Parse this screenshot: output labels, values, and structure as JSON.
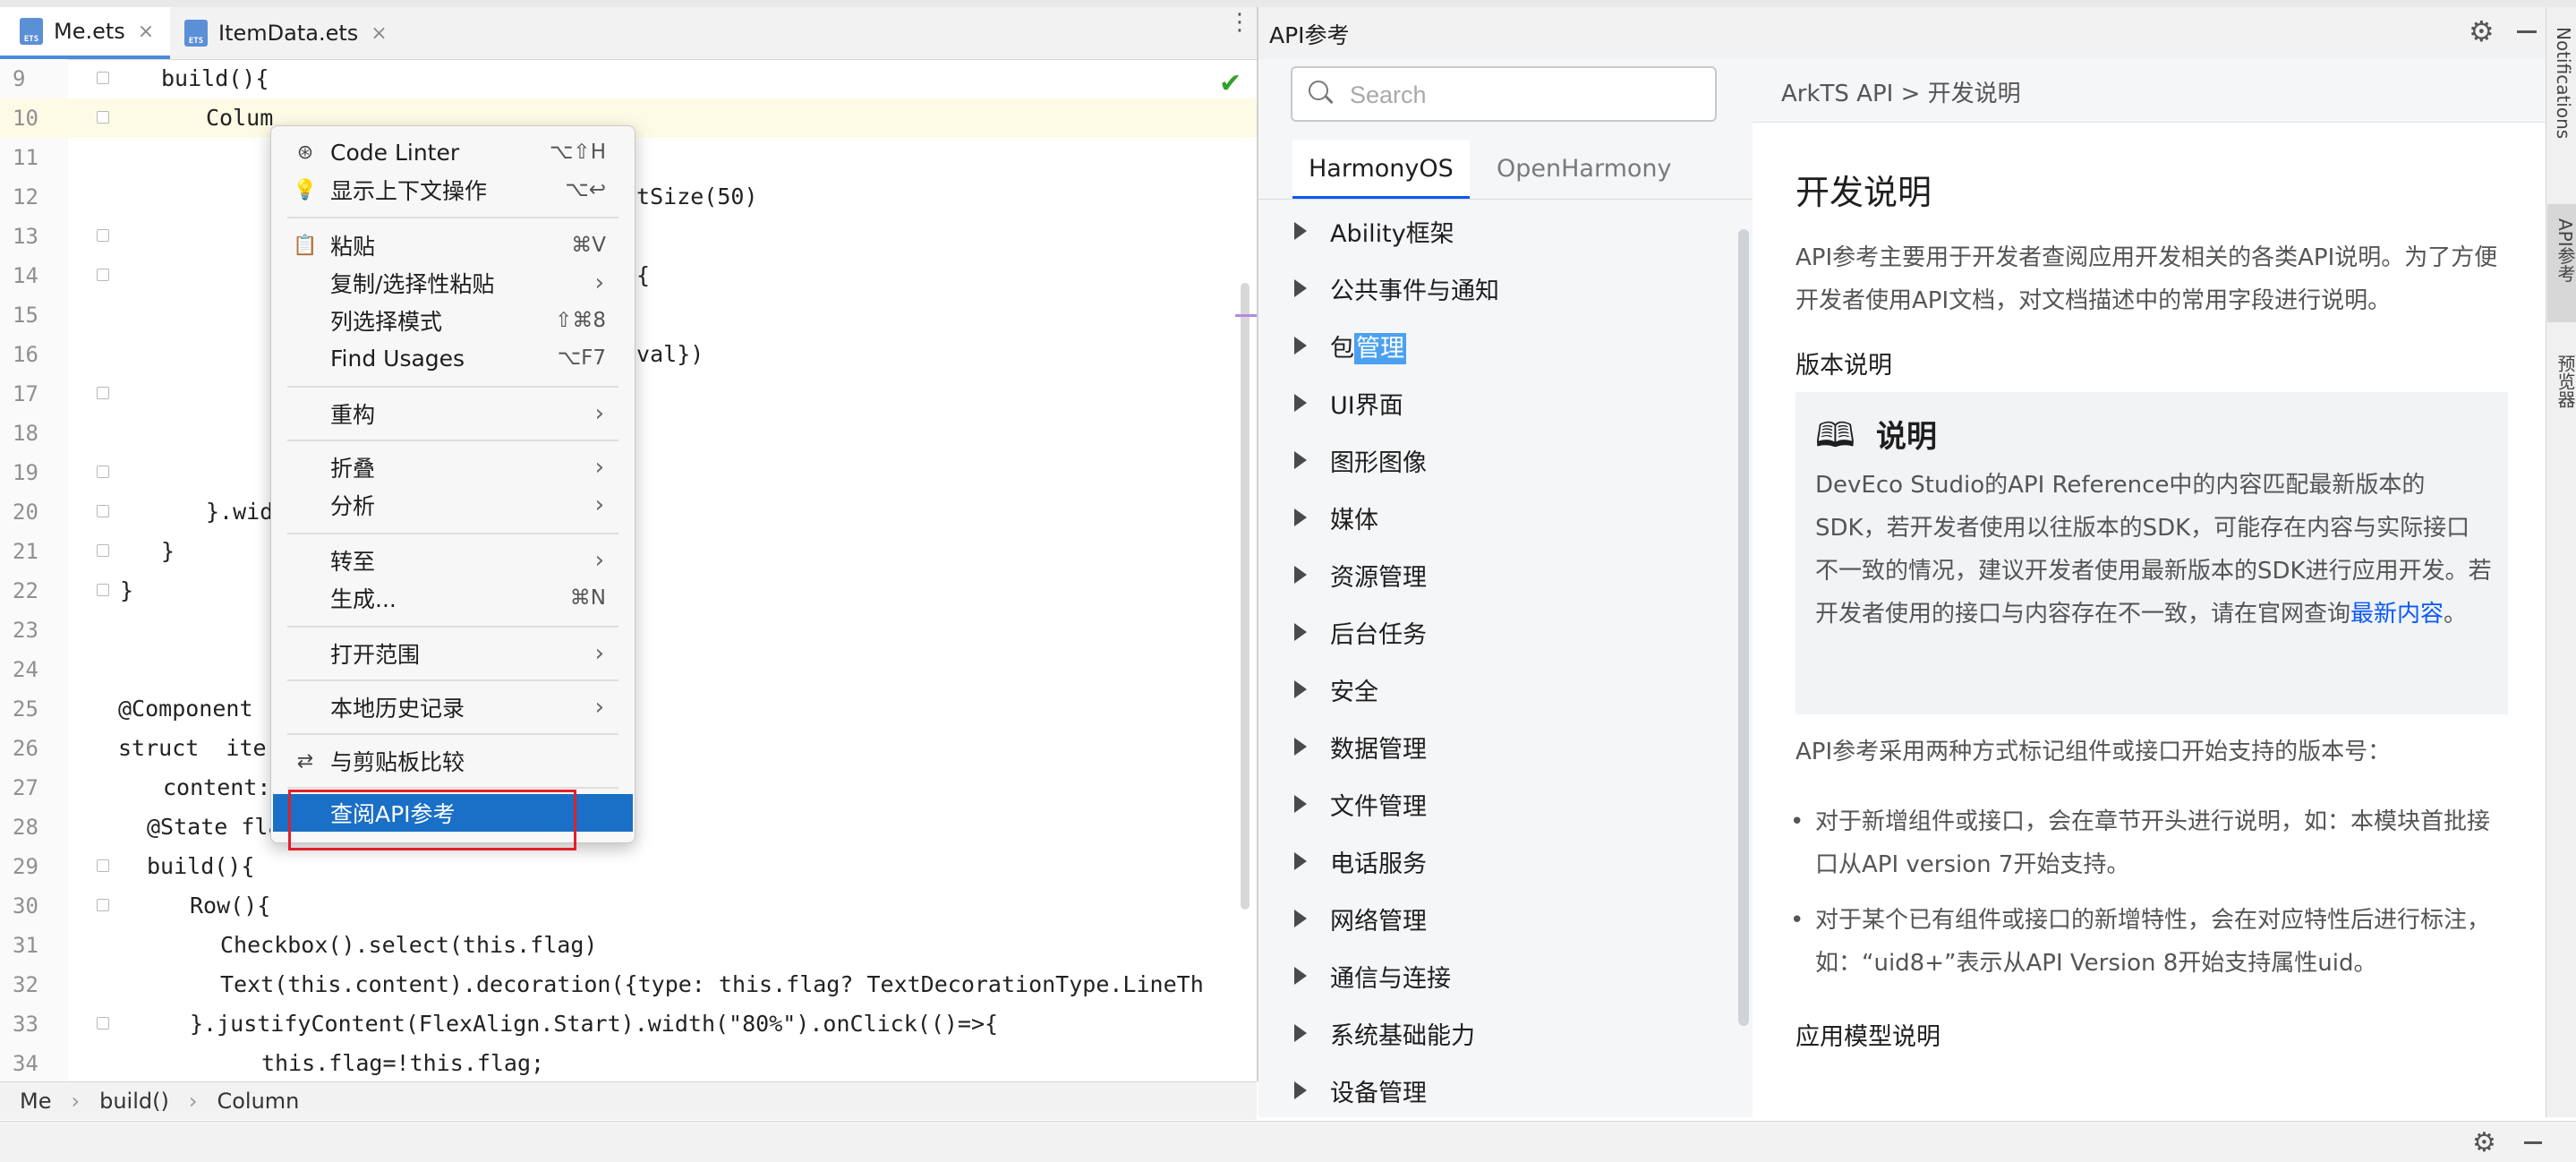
{
  "editor": {
    "tabs": [
      {
        "label": "Me.ets",
        "type": "ETS",
        "active": true
      },
      {
        "label": "ItemData.ets",
        "type": "ETS",
        "active": false
      }
    ],
    "lines": [
      {
        "n": "9",
        "code": "build(){"
      },
      {
        "n": "10",
        "code": "Colum"
      },
      {
        "n": "11",
        "code": ""
      },
      {
        "n": "12",
        "code": "ntSize(50)"
      },
      {
        "n": "13",
        "code": ""
      },
      {
        "n": "14",
        "code": ">{"
      },
      {
        "n": "15",
        "code": ""
      },
      {
        "n": "16",
        "code": ":val})"
      },
      {
        "n": "17",
        "code": ""
      },
      {
        "n": "18",
        "code": ""
      },
      {
        "n": "19",
        "code": ""
      },
      {
        "n": "20",
        "code": "}.wid"
      },
      {
        "n": "21",
        "code": "}"
      },
      {
        "n": "22",
        "code": "}"
      },
      {
        "n": "23",
        "code": ""
      },
      {
        "n": "24",
        "code": ""
      },
      {
        "n": "25",
        "code": "@Component"
      },
      {
        "n": "26",
        "code": "struct  ite"
      },
      {
        "n": "27",
        "code": "content:"
      },
      {
        "n": "28",
        "code": "@State flag:boolean=true"
      },
      {
        "n": "29",
        "code": "build(){"
      },
      {
        "n": "30",
        "code": "Row(){"
      },
      {
        "n": "31",
        "code": "Checkbox().select(this.flag)"
      },
      {
        "n": "32",
        "code": "Text(this.content).decoration({type: this.flag? TextDecorationType.LineTh"
      },
      {
        "n": "33",
        "code": "}.justifyContent(FlexAlign.Start).width(\"80%\").onClick(()=>{"
      },
      {
        "n": "34",
        "code": "this.flag=!this.flag;"
      }
    ],
    "breadcrumb": [
      "Me",
      "build()",
      "Column"
    ]
  },
  "context_menu": {
    "items": [
      {
        "icon": "code-linter-icon",
        "label": "Code Linter",
        "shortcut": "⌥⇧H"
      },
      {
        "icon": "bulb-icon",
        "label": "显示上下文操作",
        "shortcut": "⌥↩"
      },
      {
        "icon": "clipboard-icon",
        "label": "粘贴",
        "shortcut": "⌘V"
      },
      {
        "icon": "",
        "label": "复制/选择性粘贴",
        "submenu": true
      },
      {
        "icon": "",
        "label": "列选择模式",
        "shortcut": "⇧⌘8"
      },
      {
        "icon": "",
        "label": "Find Usages",
        "shortcut": "⌥F7"
      },
      {
        "icon": "",
        "label": "重构",
        "submenu": true
      },
      {
        "icon": "",
        "label": "折叠",
        "submenu": true
      },
      {
        "icon": "",
        "label": "分析",
        "submenu": true
      },
      {
        "icon": "",
        "label": "转至",
        "submenu": true
      },
      {
        "icon": "",
        "label": "生成...",
        "shortcut": "⌘N"
      },
      {
        "icon": "",
        "label": "打开范围",
        "submenu": true
      },
      {
        "icon": "",
        "label": "本地历史记录",
        "submenu": true
      },
      {
        "icon": "compare-icon",
        "label": "与剪贴板比较"
      },
      {
        "icon": "",
        "label": "查阅API参考",
        "selected": true
      }
    ]
  },
  "api_panel": {
    "title": "API参考",
    "search": {
      "placeholder": "Search",
      "value": ""
    },
    "os_tabs": [
      "HarmonyOS",
      "OpenHarmony"
    ],
    "nav": [
      "Ability框架",
      "公共事件与通知",
      "包管理",
      "UI界面",
      "图形图像",
      "媒体",
      "资源管理",
      "后台任务",
      "安全",
      "数据管理",
      "文件管理",
      "电话服务",
      "网络管理",
      "通信与连接",
      "系统基础能力",
      "设备管理"
    ],
    "nav_highlight": {
      "prefix": "包",
      "highlighted": "管理"
    },
    "crumb": "ArkTS API > 开发说明",
    "doc": {
      "h1": "开发说明",
      "p1": "API参考主要用于开发者查阅应用开发相关的各类API说明。为了方便开发者使用API文档，对文档描述中的常用字段进行说明。",
      "h_version": "版本说明",
      "note_title": "说明",
      "note_body": "DevEco Studio的API Reference中的内容匹配最新版本的SDK，若开发者使用以往版本的SDK，可能存在内容与实际接口不一致的情况，建议开发者使用最新版本的SDK进行应用开发。若开发者使用的接口与内容存在不一致，请在官网查询",
      "note_link": "最新内容",
      "note_end": "。",
      "p2": "API参考采用两种方式标记组件或接口开始支持的版本号：",
      "bullets": [
        "对于新增组件或接口，会在章节开头进行说明，如：本模块首批接口从API version 7开始支持。",
        "对于某个已有组件或接口的新增特性，会在对应特性后进行标注，如：“uid8+”表示从API Version 8开始支持属性uid。"
      ],
      "h_next": "应用模型说明"
    }
  },
  "right_strip": [
    "Notifications",
    "API参考",
    "预览器"
  ],
  "colors": {
    "accent": "#1a6fc6",
    "highlight_box": "#e1202a",
    "link": "#0a59f7"
  }
}
